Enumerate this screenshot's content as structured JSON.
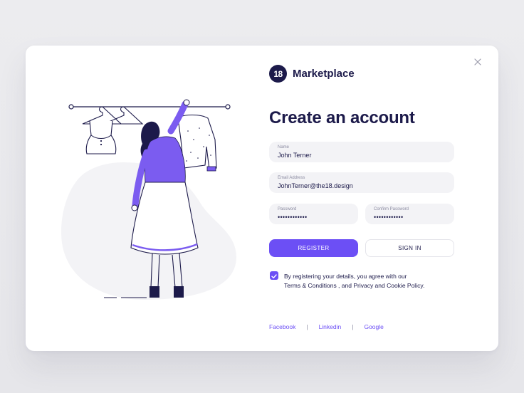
{
  "brand": {
    "logo_text": "18",
    "name": "Marketplace"
  },
  "title": "Create an account",
  "form": {
    "name": {
      "label": "Name",
      "value": "John Terner"
    },
    "email": {
      "label": "Email Address",
      "value": "JohnTerner@the18.design"
    },
    "password": {
      "label": "Password",
      "value": "••••••••••••"
    },
    "confirm_password": {
      "label": "Confirm Password",
      "value": "••••••••••••"
    },
    "register_label": "REGISTER",
    "signin_label": "SIGN IN",
    "agree_checked": true,
    "terms_line1": "By registering your details, you agree with our",
    "terms_line2": "Terms & Conditions , and Privacy and Cookie Policy."
  },
  "social": {
    "facebook": "Facebook",
    "linkedin": "Linkedin",
    "google": "Google",
    "separator": "|"
  },
  "icons": {
    "close": "close-icon",
    "check": "check-icon"
  },
  "colors": {
    "accent": "#6c4ff5",
    "navy": "#1c1a4a",
    "field_bg": "#f3f3f6"
  }
}
